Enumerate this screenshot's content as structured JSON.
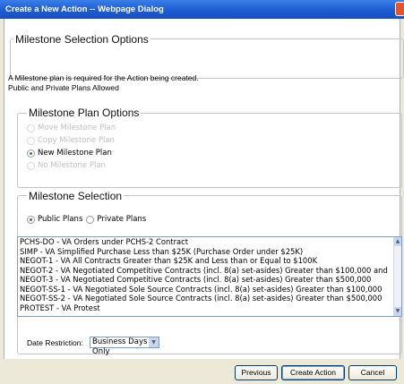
{
  "window": {
    "title": "Create a New Action -- Webpage Dialog"
  },
  "milestone_options": {
    "title": "Milestone Selection Options",
    "info_line1": "A Milestone plan is required for the Action being created.",
    "info_line2": "Public and Private Plans Allowed"
  },
  "plan_options": {
    "legend": "Milestone Plan Options",
    "items": [
      {
        "label": "Move Milestone Plan",
        "checked": false,
        "disabled": true
      },
      {
        "label": "Copy Milestone Plan",
        "checked": false,
        "disabled": true
      },
      {
        "label": "New Milestone Plan",
        "checked": true,
        "disabled": false
      },
      {
        "label": "No Milestone Plan",
        "checked": false,
        "disabled": true
      }
    ]
  },
  "milestone_selection": {
    "legend": "Milestone Selection",
    "public_label": "Public Plans",
    "private_label": "Private Plans",
    "selected_type": "public",
    "plans": [
      "PCHS-DO - VA Orders under PCHS-2 Contract",
      "SIMP - VA Simplified Purchase Less than $25K (Purchase Order under $25K)",
      "NEGOT-1 - VA All Contracts Greater than $25K and Less than or Equal to $100K",
      "NEGOT-2 - VA Negotiated Competitive Contracts (incl. 8(a) set-asides) Greater than $100,000 and",
      "NEGOT-3 - VA Negotiated Competitive Contracts (incl. 8(a) set-asides) Greater than $500,000",
      "NEGOT-SS-1 - VA Negotiated Sole Source Contracts (incl. 8(a) set-asides) Greater than $100,000",
      "NEGOT-SS-2 - VA Negotiated Sole Source Contracts (incl. 8(a) set-asides) Greater than $500,000",
      "PROTEST - VA Protest"
    ]
  },
  "date_restriction": {
    "label": "Date Restriction:",
    "value": "Business Days Only"
  },
  "buttons": {
    "previous": "Previous",
    "create": "Create Action",
    "cancel": "Cancel"
  },
  "colors": {
    "titlebar": "#1c5bd4",
    "selected_radio": "#2a8a2a"
  }
}
